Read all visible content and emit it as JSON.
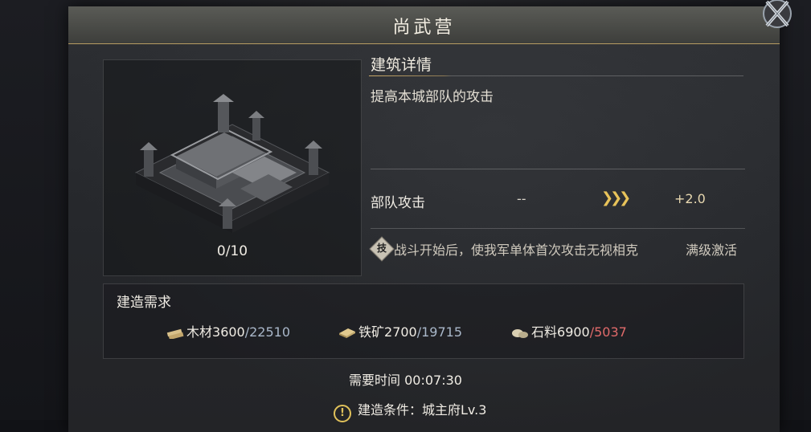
{
  "window": {
    "title": "尚武营"
  },
  "building": {
    "progress": "0/10"
  },
  "detail": {
    "heading": "建筑详情",
    "description": "提高本城部队的攻击",
    "stat": {
      "label": "部队攻击",
      "current": "--",
      "next": "+2.0"
    },
    "skill": {
      "badge": "技",
      "text": "战斗开始后，使我军单体首次攻击无视相克",
      "status": "满级激活"
    }
  },
  "requirements": {
    "title": "建造需求",
    "resources": [
      {
        "name": "木材",
        "have": "3600",
        "need": "/22510",
        "sufficient": true,
        "icon": "wood-icon"
      },
      {
        "name": "铁矿",
        "have": "2700",
        "need": "/19715",
        "sufficient": true,
        "icon": "iron-icon"
      },
      {
        "name": "石料",
        "have": "6900",
        "need": "/5037",
        "sufficient": false,
        "icon": "stone-icon"
      }
    ]
  },
  "time": {
    "label": "需要时间",
    "value": "00:07:30"
  },
  "condition": {
    "icon": "!",
    "text": "建造条件：城主府Lv.3"
  },
  "colors": {
    "accent": "#e8c35a",
    "insufficient": "#e06a6a",
    "panel": "#2d2f33"
  }
}
